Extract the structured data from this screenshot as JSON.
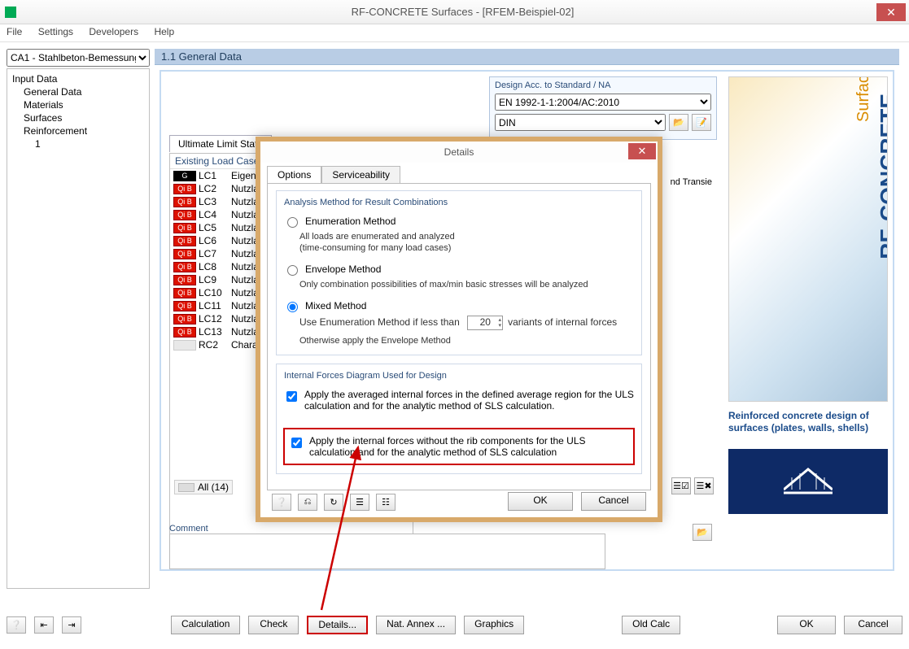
{
  "window": {
    "title": "RF-CONCRETE Surfaces - [RFEM-Beispiel-02]"
  },
  "menu": {
    "file": "File",
    "settings": "Settings",
    "developers": "Developers",
    "help": "Help"
  },
  "leftpanel": {
    "combo": "CA1 - Stahlbeton-Bemessung",
    "tree": {
      "root": "Input Data",
      "n1": "General Data",
      "n2": "Materials",
      "n3": "Surfaces",
      "n4": "Reinforcement",
      "n4a": "1"
    }
  },
  "main": {
    "title": "1.1 General Data",
    "designacc": {
      "hdr": "Design Acc. to Standard / NA",
      "std": "EN 1992-1-1:2004/AC:2010",
      "na": "DIN"
    },
    "tabs": {
      "uls": "Ultimate Limit State"
    },
    "lc": {
      "hdr": "Existing Load Cases",
      "rows": [
        {
          "b": "G",
          "c1": "LC1",
          "c2": "Eigen"
        },
        {
          "b": "Qi B",
          "c1": "LC2",
          "c2": "Nutzla"
        },
        {
          "b": "Qi B",
          "c1": "LC3",
          "c2": "Nutzla"
        },
        {
          "b": "Qi B",
          "c1": "LC4",
          "c2": "Nutzla"
        },
        {
          "b": "Qi B",
          "c1": "LC5",
          "c2": "Nutzla"
        },
        {
          "b": "Qi B",
          "c1": "LC6",
          "c2": "Nutzla"
        },
        {
          "b": "Qi B",
          "c1": "LC7",
          "c2": "Nutzla"
        },
        {
          "b": "Qi B",
          "c1": "LC8",
          "c2": "Nutzla"
        },
        {
          "b": "Qi B",
          "c1": "LC9",
          "c2": "Nutzla"
        },
        {
          "b": "Qi B",
          "c1": "LC10",
          "c2": "Nutzla"
        },
        {
          "b": "Qi B",
          "c1": "LC11",
          "c2": "Nutzla"
        },
        {
          "b": "Qi B",
          "c1": "LC12",
          "c2": "Nutzla"
        },
        {
          "b": "Qi B",
          "c1": "LC13",
          "c2": "Nutzla"
        },
        {
          "b": "",
          "c1": "RC2",
          "c2": "Chara"
        }
      ],
      "selected_hdr": "nd Transie"
    },
    "all": "All (14)",
    "logo": {
      "l1": "RF-CONCRETE",
      "l2": "Surfaces",
      "desc": "Reinforced concrete design of surfaces (plates, walls, shells)"
    },
    "comment": "Comment"
  },
  "bottom": {
    "calc": "Calculation",
    "check": "Check",
    "details": "Details...",
    "annex": "Nat. Annex ...",
    "graphics": "Graphics",
    "oldcalc": "Old Calc",
    "ok": "OK",
    "cancel": "Cancel"
  },
  "modal": {
    "title": "Details",
    "tabs": {
      "opt": "Options",
      "serv": "Serviceability"
    },
    "fs1": {
      "leg": "Analysis Method for Result Combinations",
      "r1": "Enumeration Method",
      "r1s1": "All loads are enumerated and analyzed",
      "r1s2": "(time-consuming for many load cases)",
      "r2": "Envelope Method",
      "r2s": "Only combination possibilities of max/min basic stresses will be analyzed",
      "r3": "Mixed Method",
      "r3s1": "Use Enumeration Method if less than",
      "r3v": "20",
      "r3s2": "variants of internal forces",
      "r3s3": "Otherwise apply the Envelope Method"
    },
    "fs2": {
      "leg": "Internal Forces Diagram Used for Design",
      "c1": "Apply the averaged internal forces in the defined average region for the ULS calculation and for the analytic method of SLS calculation.",
      "c2": "Apply the internal forces without the rib components for the ULS calculation and for the analytic method of SLS calculation"
    },
    "ok": "OK",
    "cancel": "Cancel"
  }
}
